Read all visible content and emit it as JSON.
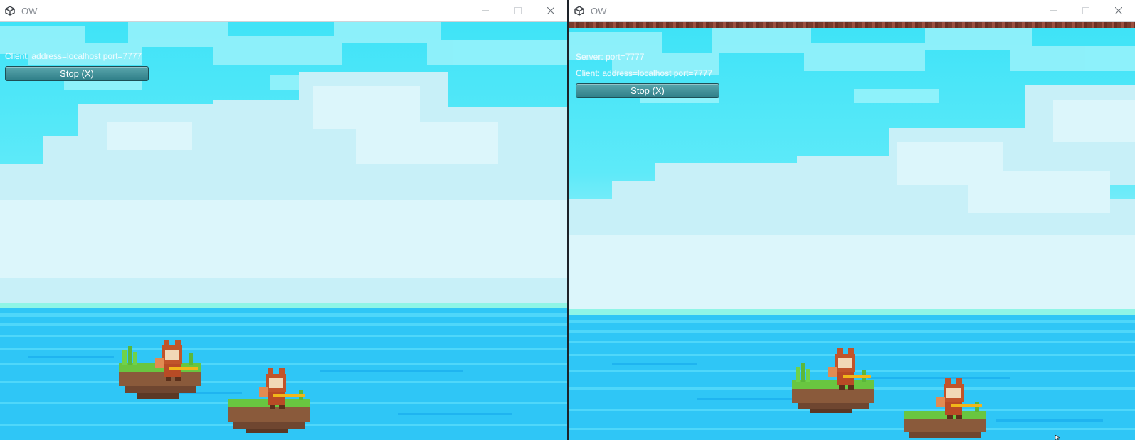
{
  "left_window": {
    "title": "OW",
    "icon": "unity-logo-icon",
    "hud": {
      "client_line": "Client: address=localhost port=7777",
      "stop_button": "Stop (X)"
    }
  },
  "right_window": {
    "title": "OW",
    "icon": "unity-logo-icon",
    "hud": {
      "server_line": "Server: port=7777",
      "client_line": "Client: address=localhost port=7777",
      "stop_button": "Stop (X)"
    }
  },
  "window_controls": [
    "minimize-icon",
    "maximize-icon",
    "close-icon"
  ],
  "colors": {
    "sky": "#3fe3f7",
    "cloud_light": "#d6f6fb",
    "sea": "#2fc6f6",
    "button": "#3b8d96"
  }
}
